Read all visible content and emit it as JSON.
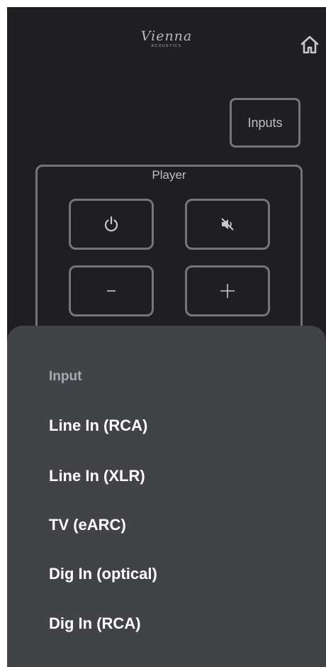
{
  "header": {
    "logo_script": "Vienna",
    "logo_sub": "ACOUSTICS",
    "home_icon": "home-icon"
  },
  "inputs_button": {
    "label": "Inputs"
  },
  "player": {
    "title": "Player",
    "controls": [
      {
        "name": "power",
        "icon": "power-icon"
      },
      {
        "name": "mute",
        "icon": "mute-icon"
      },
      {
        "name": "volume-down",
        "icon": "minus-icon",
        "glyph": "−"
      },
      {
        "name": "volume-up",
        "icon": "plus-icon",
        "glyph": "+"
      }
    ]
  },
  "input_sheet": {
    "title": "Input",
    "options": [
      "Line In (RCA)",
      "Line In (XLR)",
      "TV (eARC)",
      "Dig In (optical)",
      "Dig In (RCA)"
    ]
  },
  "colors": {
    "background": "#1f1f21",
    "border": "#76767a",
    "sheet": "#424346",
    "sheet_title": "#a9a9b3",
    "option_text": "#ffffff"
  }
}
